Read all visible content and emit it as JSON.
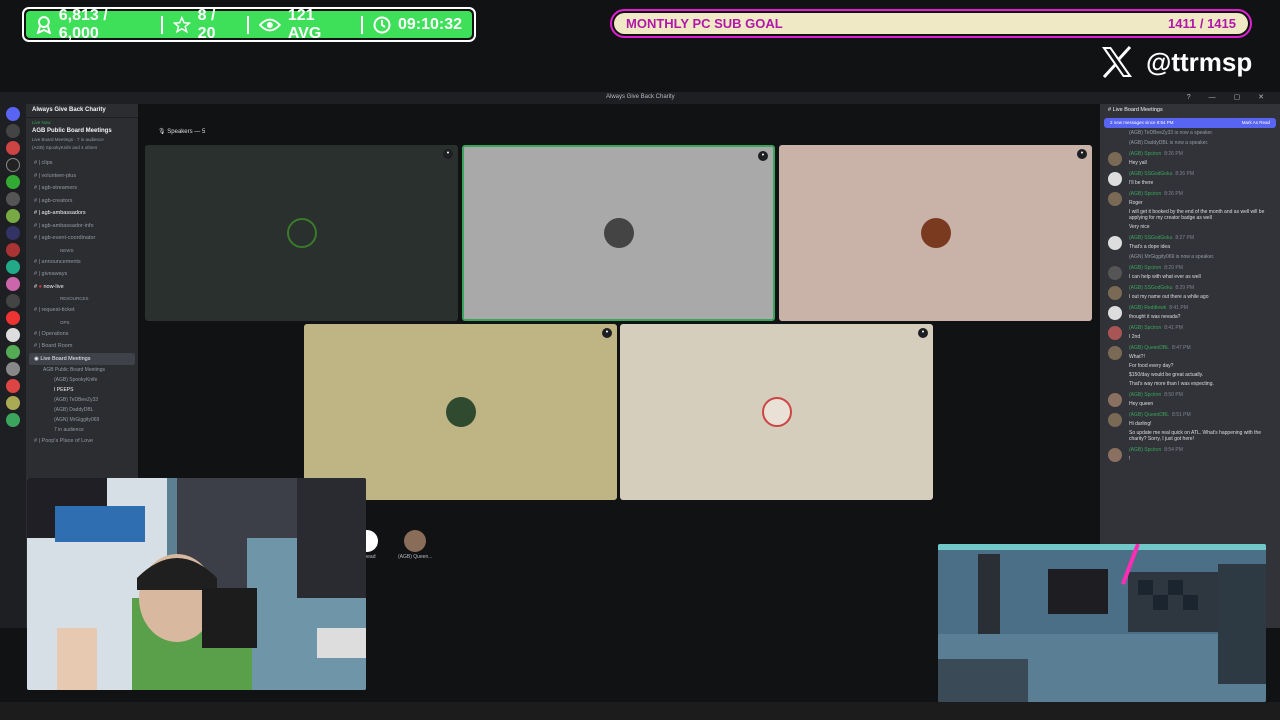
{
  "overlay": {
    "followers": "6,813 / 6,000",
    "stars": "8 / 20",
    "viewers": "121 AVG",
    "timer": "09:10:32",
    "goal_label": "MONTHLY PC SUB GOAL",
    "goal_value": "1411 / 1415",
    "goal_progress": 0.997,
    "handle": "@ttrmsp",
    "colors": {
      "stats_green": "#3ee05a",
      "goal_border": "#e11fd2",
      "goal_fill": "#f0e9c5"
    }
  },
  "window": {
    "title": "Always Give Back Charity",
    "controls": [
      "?",
      "—",
      "▢",
      "✕"
    ]
  },
  "sidebar": {
    "server_name": "Always Give Back Charity",
    "live_now": "Live Now",
    "stage_title": "AGB Public Board Meetings",
    "stage_sub1": "Live Board Meetings · 7 in audience",
    "stage_sub2": "(AGB) SpookyKnife and 4 others",
    "channels": [
      "clips",
      "volunteer-plus",
      "agb-streamers",
      "agb-creators",
      "agb-ambassadors",
      "agb-ambassador-info",
      "agb-event-coordinator"
    ],
    "cat_news": "NEWS",
    "news_channels": [
      "announcements",
      "giveaways",
      "now-live"
    ],
    "cat_resources": "RESOURCES",
    "resource_channels": [
      "request-ticket"
    ],
    "cat_ops": "OPS",
    "ops_channels": [
      "Operations",
      "Board Room",
      "Live Board Meetings"
    ],
    "stage_subline": "AGB Public Board Meetings",
    "voice_members": [
      "(AGB) SpookyKnife",
      "I PEEPS",
      "(AGB) TeDBeeZy33",
      "(AGB) DaddyDBL",
      "(AGN) MrGiggity069",
      "7 in audience"
    ],
    "bottom_channel": "Poop's Place of Love"
  },
  "stage": {
    "speakers_label": "Speakers — 5",
    "audience": [
      "...rhead",
      "(AGB) Queen..."
    ]
  },
  "chat": {
    "header": "Live Board Meetings",
    "new_messages": "2 new messages since 8:54 PM",
    "mark_read": "Mark As Read",
    "messages": [
      {
        "type": "sys",
        "text": "(AGB) TeDBeeZy33 is now a speaker."
      },
      {
        "type": "sys",
        "text": "(AGB) DaddyDBL is now a speaker."
      },
      {
        "user": "(AGB) Spciron",
        "time": "8:26 PM",
        "lines": [
          "Hey yall"
        ]
      },
      {
        "user": "(AGB) SSGodGoku",
        "time": "8:26 PM",
        "lines": [
          "I'll be there"
        ]
      },
      {
        "user": "(AGB) Spciron",
        "time": "8:26 PM",
        "lines": [
          "Roger",
          "I will get it booked by the end of the month and as well will be applying for my creator badge as well",
          "Very nice"
        ]
      },
      {
        "user": "(AGB) SSGodGoku",
        "time": "8:27 PM",
        "lines": [
          "That's a dope idea"
        ]
      },
      {
        "type": "sys",
        "text": "(AGN) MrGiggity069 is now a speaker."
      },
      {
        "user": "(AGB) Spciron",
        "time": "8:29 PM",
        "lines": [
          "I can help with what ever as well"
        ]
      },
      {
        "user": "(AGB) SSGodGoku",
        "time": "8:29 PM",
        "lines": [
          "I out my name out there a while ago"
        ]
      },
      {
        "user": "(AGB) Reddlewk",
        "time": "8:41 PM",
        "lines": [
          "thought it was nevada?"
        ]
      },
      {
        "user": "(AGB) Spciron",
        "time": "8:41 PM",
        "lines": [
          "I 2nd"
        ]
      },
      {
        "user": "(AGB) QueenDBL",
        "time": "8:47 PM",
        "lines": [
          "What?!",
          "For food every day?",
          "$150/day would be great actually.",
          "That's way more than I was expecting."
        ]
      },
      {
        "user": "(AGB) Spciron",
        "time": "8:50 PM",
        "lines": [
          "Hey queen"
        ]
      },
      {
        "user": "(AGB) QueenDBL",
        "time": "8:51 PM",
        "lines": [
          "Hi darling!",
          "So update me real quick on ATL. What's happening with the charity? Sorry, I just got here!"
        ]
      },
      {
        "user": "(AGB) Spciron",
        "time": "8:54 PM",
        "lines": [
          "!"
        ]
      }
    ]
  }
}
